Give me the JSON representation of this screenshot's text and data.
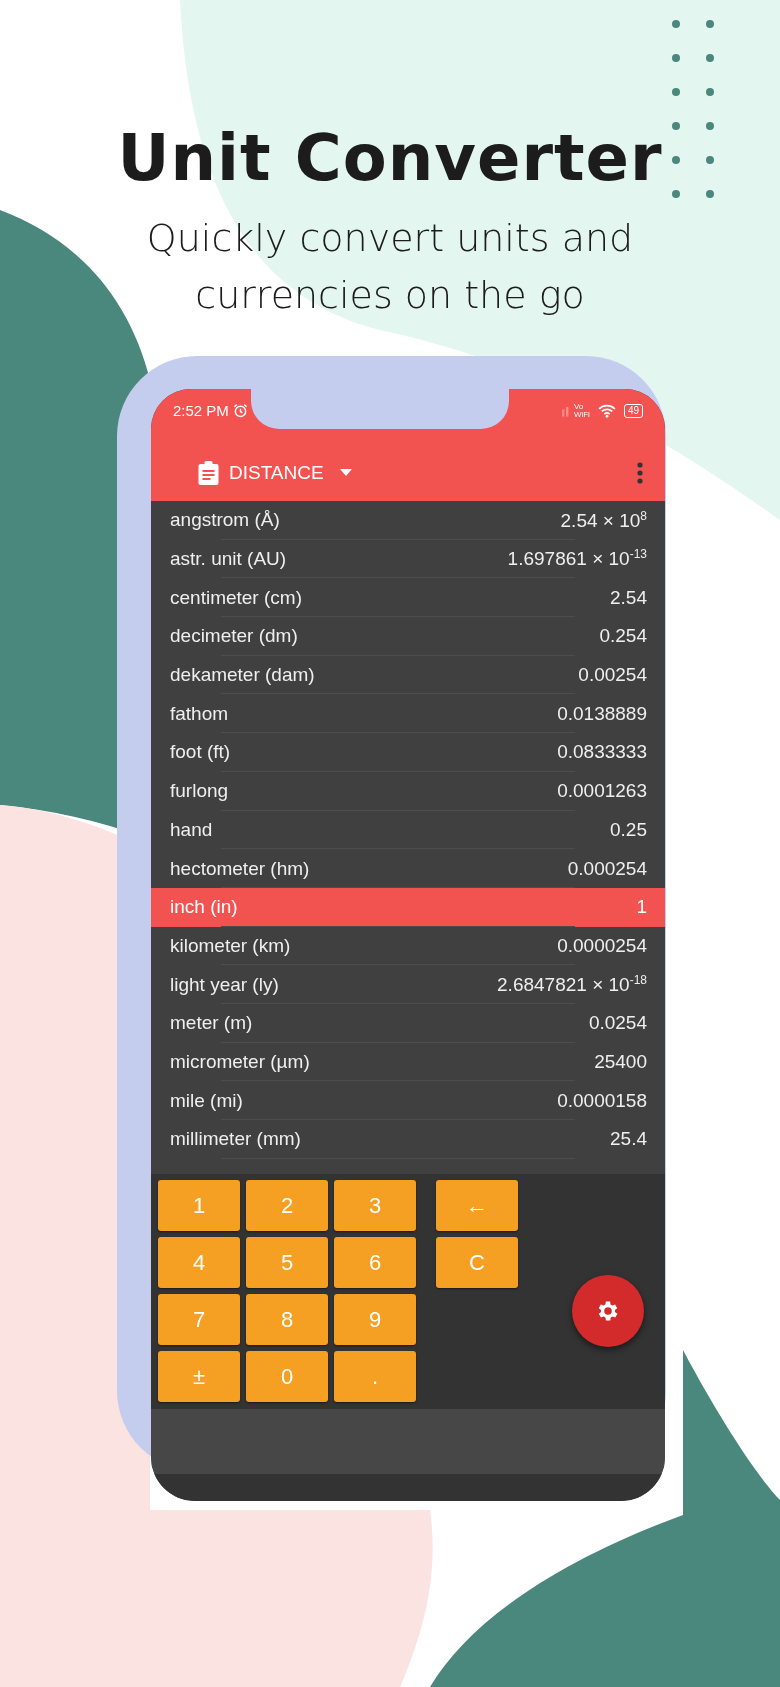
{
  "headline": {
    "title": "Unit Converter",
    "subtitle_lines": [
      "Quickly convert units and",
      "currencies on the go"
    ]
  },
  "phone": {
    "status_bar": {
      "time": "2:52 PM",
      "network_label": [
        "Vo",
        "WiFi"
      ],
      "battery": "49"
    },
    "app_bar": {
      "category": "DISTANCE"
    },
    "units": [
      {
        "name": "angstrom (Å)",
        "value": "2.54 × 10$^{8}$",
        "selected": false
      },
      {
        "name": "astr. unit (AU)",
        "value": "1.697861 × 10$^{-13}$",
        "selected": false
      },
      {
        "name": "centimeter (cm)",
        "value": "2.54",
        "selected": false
      },
      {
        "name": "decimeter (dm)",
        "value": "0.254",
        "selected": false
      },
      {
        "name": "dekameter (dam)",
        "value": "0.00254",
        "selected": false
      },
      {
        "name": "fathom",
        "value": "0.0138889",
        "selected": false
      },
      {
        "name": "foot (ft)",
        "value": "0.0833333",
        "selected": false
      },
      {
        "name": "furlong",
        "value": "0.0001263",
        "selected": false
      },
      {
        "name": "hand",
        "value": "0.25",
        "selected": false
      },
      {
        "name": "hectometer (hm)",
        "value": "0.000254",
        "selected": false
      },
      {
        "name": "inch (in)",
        "value": "1",
        "selected": true
      },
      {
        "name": "kilometer (km)",
        "value": "0.0000254",
        "selected": false
      },
      {
        "name": "light year (ly)",
        "value": "2.6847821 × 10$^{-18}$",
        "selected": false
      },
      {
        "name": "meter (m)",
        "value": "0.0254",
        "selected": false
      },
      {
        "name": "micrometer (µm)",
        "value": "25400",
        "selected": false
      },
      {
        "name": "mile (mi)",
        "value": "0.0000158",
        "selected": false
      },
      {
        "name": "millimeter (mm)",
        "value": "25.4",
        "selected": false
      }
    ],
    "keypad": {
      "digit_keys": [
        "1",
        "2",
        "3",
        "4",
        "5",
        "6",
        "7",
        "8",
        "9",
        "±",
        "0",
        "."
      ],
      "side_keys": [
        "←",
        "C"
      ]
    }
  }
}
